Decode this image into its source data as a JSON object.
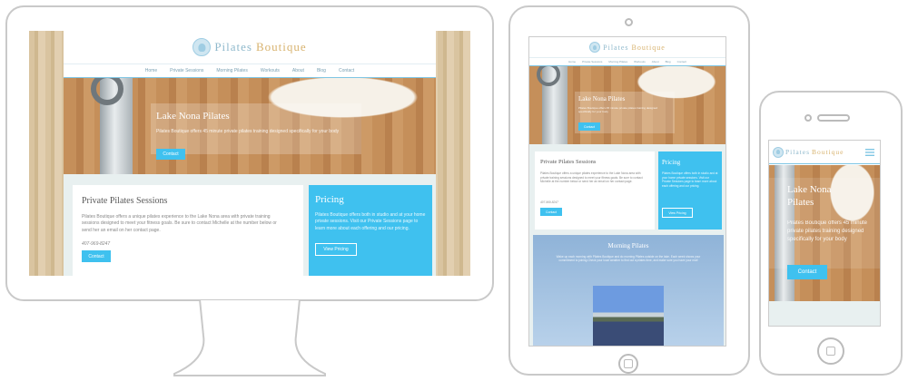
{
  "site": {
    "logo_part1": "Pilates",
    "logo_part2": "Boutique",
    "nav": [
      "Home",
      "Private Sessions",
      "Morning Pilates",
      "Workouts",
      "About",
      "Blog",
      "Contact"
    ],
    "hero": {
      "title": "Lake Nona Pilates",
      "text": "Pilates Boutique offers 45 minute private pilates training designed specifically for your body",
      "button": "Contact"
    },
    "private": {
      "title": "Private Pilates Sessions",
      "text": "Pilates Boutique offers a unique pilates experience to the Lake Nona area with private training sessions designed to meet your fitness goals. Be sure to contact Michelle at the number below or send her an email on her contact page.",
      "phone": "407-969-8247",
      "button": "Contact"
    },
    "pricing": {
      "title": "Pricing",
      "text": "Pilates Boutique offers both in studio and at your home private sessions. Visit our Private Sessions page to learn more about each offering and our pricing.",
      "button": "View Pricing"
    },
    "morning": {
      "title": "Morning Pilates",
      "text": "Wake up each morning with Pilates Boutique and do morning Pilates outside on the lake. Each week shows your commitment to joining.Check your local weather to find out a pilates time, and make sure you have your mat!"
    }
  },
  "phone_view": {
    "hero_title": "Lake Nona Pilates",
    "hero_text": "Pilates Boutique offers 45 minute private pilates training designed specifically for your body",
    "button": "Contact",
    "menu_icon": "hamburger-menu-icon"
  },
  "colors": {
    "accent": "#3fc1ef",
    "logo_blue": "#8fb9cc",
    "logo_gold": "#d8b36f",
    "frame": "#c9c9c9"
  }
}
